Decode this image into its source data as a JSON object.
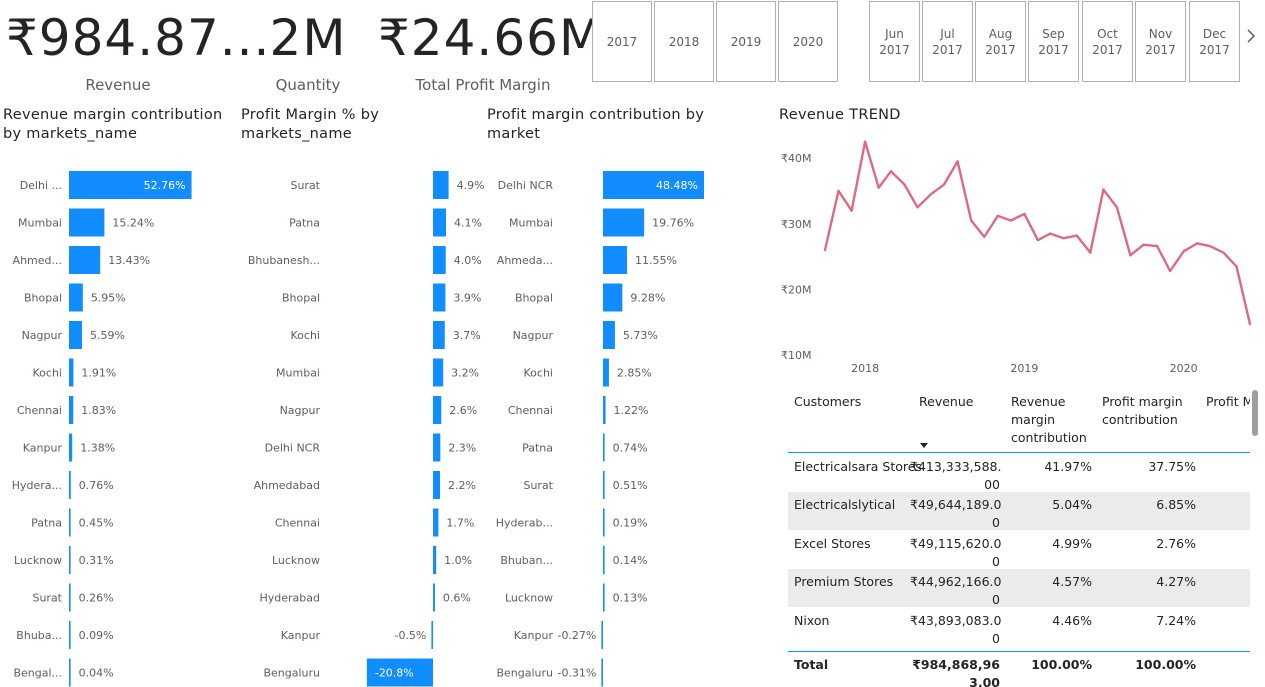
{
  "kpis": [
    {
      "value": "₹984.87...",
      "label": "Revenue"
    },
    {
      "value": "2M",
      "label": "Quantity"
    },
    {
      "value": "₹24.66M",
      "label": "Total Profit Margin"
    }
  ],
  "year_slicer": [
    "2017",
    "2018",
    "2019",
    "2020"
  ],
  "month_slicer": [
    [
      "Jun",
      "2017"
    ],
    [
      "Jul",
      "2017"
    ],
    [
      "Aug",
      "2017"
    ],
    [
      "Sep",
      "2017"
    ],
    [
      "Oct",
      "2017"
    ],
    [
      "Nov",
      "2017"
    ],
    [
      "Dec",
      "2017"
    ]
  ],
  "colors": {
    "bar": "#118dff",
    "line": "#dd6b7f",
    "header_line": "#118dff",
    "alt_row": "#ebebeb"
  },
  "icons": {
    "next": "chevron-right-icon"
  },
  "chart_data": [
    {
      "type": "bar",
      "title": "Revenue margin contribution by markets_name",
      "categories": [
        "Delhi ...",
        "Mumbai",
        "Ahmed...",
        "Bhopal",
        "Nagpur",
        "Kochi",
        "Chennai",
        "Kanpur",
        "Hydera...",
        "Patna",
        "Lucknow",
        "Surat",
        "Bhuba...",
        "Bengal..."
      ],
      "values": [
        52.76,
        15.24,
        13.43,
        5.95,
        5.59,
        1.91,
        1.83,
        1.38,
        0.76,
        0.45,
        0.31,
        0.26,
        0.09,
        0.04
      ],
      "labels": [
        "52.76%",
        "15.24%",
        "13.43%",
        "5.95%",
        "5.59%",
        "1.91%",
        "1.83%",
        "1.38%",
        "0.76%",
        "0.45%",
        "0.31%",
        "0.26%",
        "0.09%",
        "0.04%"
      ]
    },
    {
      "type": "bar",
      "title": "Profit Margin % by markets_name",
      "categories": [
        "Surat",
        "Patna",
        "Bhubanesh...",
        "Bhopal",
        "Kochi",
        "Mumbai",
        "Nagpur",
        "Delhi NCR",
        "Ahmedabad",
        "Chennai",
        "Lucknow",
        "Hyderabad",
        "Kanpur",
        "Bengaluru"
      ],
      "values": [
        4.9,
        4.1,
        4.0,
        3.9,
        3.7,
        3.2,
        2.6,
        2.3,
        2.2,
        1.7,
        1.0,
        0.6,
        -0.5,
        -20.8
      ],
      "labels": [
        "4.9%",
        "4.1%",
        "4.0%",
        "3.9%",
        "3.7%",
        "3.2%",
        "2.6%",
        "2.3%",
        "2.2%",
        "1.7%",
        "1.0%",
        "0.6%",
        "-0.5%",
        "-20.8%"
      ]
    },
    {
      "type": "bar",
      "title": "Profit margin contribution by market",
      "categories": [
        "Delhi NCR",
        "Mumbai",
        "Ahmeda...",
        "Bhopal",
        "Nagpur",
        "Kochi",
        "Chennai",
        "Patna",
        "Surat",
        "Hyderab...",
        "Bhuban...",
        "Lucknow",
        "Kanpur",
        "Bengaluru"
      ],
      "values": [
        48.48,
        19.76,
        11.55,
        9.28,
        5.73,
        2.85,
        1.22,
        0.74,
        0.51,
        0.19,
        0.14,
        0.13,
        -0.27,
        -0.31
      ],
      "labels": [
        "48.48%",
        "19.76%",
        "11.55%",
        "9.28%",
        "5.73%",
        "2.85%",
        "1.22%",
        "0.74%",
        "0.51%",
        "0.19%",
        "0.14%",
        "0.13%",
        "-0.27%",
        "-0.31%"
      ]
    },
    {
      "type": "line",
      "title": "Revenue TREND",
      "ylim": [
        10,
        42
      ],
      "yticks": [
        10,
        20,
        30,
        40
      ],
      "ytick_labels": [
        "₹10M",
        "₹20M",
        "₹30M",
        "₹40M"
      ],
      "xticks": [
        "2018-01-01",
        "2019-01-01",
        "2020-01-01"
      ],
      "xtick_labels": [
        "2018",
        "2019",
        "2020"
      ],
      "x": [
        "2017-10-01",
        "2017-11-01",
        "2017-12-01",
        "2018-01-01",
        "2018-02-01",
        "2018-03-01",
        "2018-04-01",
        "2018-05-01",
        "2018-06-01",
        "2018-07-01",
        "2018-08-01",
        "2018-09-01",
        "2018-10-01",
        "2018-11-01",
        "2018-12-01",
        "2019-01-01",
        "2019-02-01",
        "2019-03-01",
        "2019-04-01",
        "2019-05-01",
        "2019-06-01",
        "2019-07-01",
        "2019-08-01",
        "2019-09-01",
        "2019-10-01",
        "2019-11-01",
        "2019-12-01",
        "2020-01-01",
        "2020-02-01",
        "2020-03-01",
        "2020-04-01",
        "2020-05-01",
        "2020-06-01"
      ],
      "y": [
        26,
        35,
        32,
        42.5,
        35.5,
        38,
        36,
        32.5,
        34.5,
        36,
        39.5,
        30.5,
        28,
        31.2,
        30.5,
        31.5,
        27.5,
        28.5,
        27.8,
        28.2,
        25.6,
        35.2,
        32.5,
        25.2,
        26.8,
        26.6,
        22.8,
        25.8,
        27,
        26.6,
        25.6,
        23.5,
        14.7
      ]
    }
  ],
  "table": {
    "headers": [
      "Customers",
      "Revenue",
      "Revenue margin contribution",
      "Profit margin contribution",
      "Profit M"
    ],
    "header_lines": [
      [
        "Customers"
      ],
      [
        "Revenue"
      ],
      [
        "Revenue",
        "margin",
        "contribution"
      ],
      [
        "Profit margin",
        "contribution"
      ],
      [
        "Profit M"
      ]
    ],
    "rows": [
      {
        "customer": "Electricalsara Stores",
        "revenue": [
          "₹413,333,588.",
          "00"
        ],
        "rev_contrib": "41.97%",
        "profit_contrib": "37.75%"
      },
      {
        "customer": "Electricalslytical",
        "revenue": [
          "₹49,644,189.0",
          "0"
        ],
        "rev_contrib": "5.04%",
        "profit_contrib": "6.85%"
      },
      {
        "customer": "Excel Stores",
        "revenue": [
          "₹49,115,620.0",
          "0"
        ],
        "rev_contrib": "4.99%",
        "profit_contrib": "2.76%"
      },
      {
        "customer": "Premium Stores",
        "revenue": [
          "₹44,962,166.0",
          "0"
        ],
        "rev_contrib": "4.57%",
        "profit_contrib": "4.27%"
      },
      {
        "customer": "Nixon",
        "revenue": [
          "₹43,893,083.0",
          "0"
        ],
        "rev_contrib": "4.46%",
        "profit_contrib": "7.24%"
      }
    ],
    "total": {
      "label": "Total",
      "revenue": [
        "₹984,868,96",
        "3.00"
      ],
      "rev_contrib": "100.00%",
      "profit_contrib": "100.00%"
    }
  }
}
